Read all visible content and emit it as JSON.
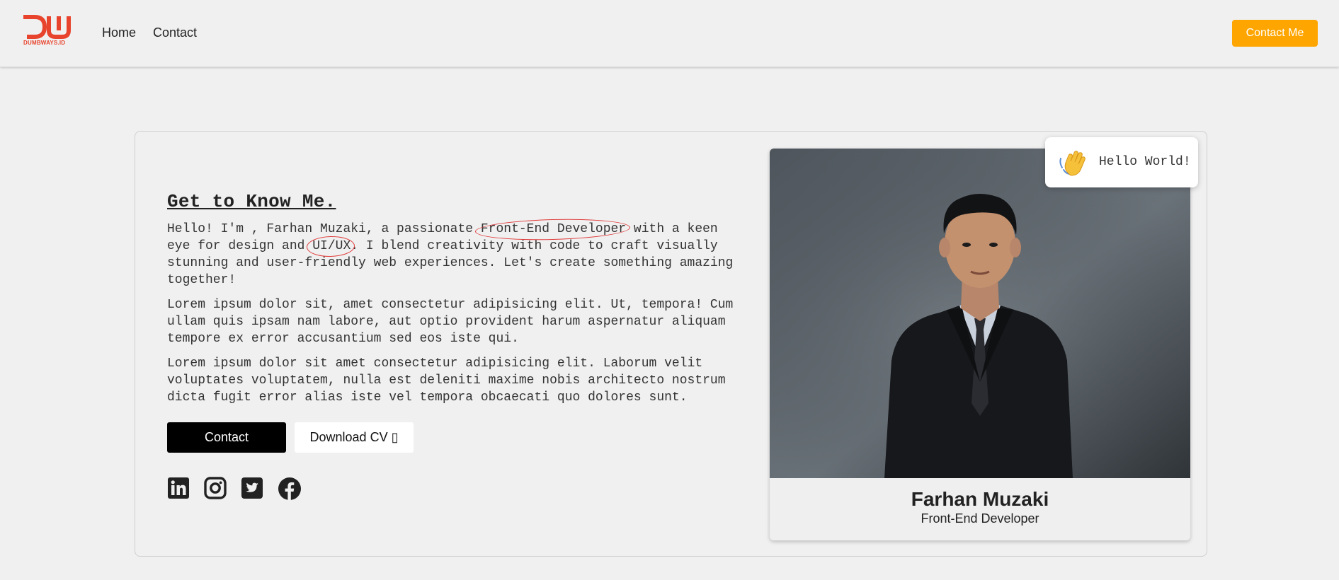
{
  "navbar": {
    "logo_text": "DUMBWAYS.ID",
    "links": [
      "Home",
      "Contact"
    ],
    "cta_label": "Contact Me"
  },
  "about": {
    "heading": "Get to Know Me.",
    "intro_before": "Hello! I'm , Farhan Muzaki, a passionate ",
    "intro_highlight_1": "Front-End Developer",
    "intro_middle": " with a keen eye for design and ",
    "intro_highlight_2": "UI/UX",
    "intro_after": ". I blend creativity with code to craft visually stunning and user-friendly web experiences. Let's create something amazing together!",
    "paragraph_2": "Lorem ipsum dolor sit, amet consectetur adipisicing elit. Ut, tempora! Cum ullam quis ipsam nam labore, aut optio provident harum aspernatur aliquam tempore ex error accusantium sed eos iste qui.",
    "paragraph_3": "Lorem ipsum dolor sit amet consectetur adipisicing elit. Laborum velit voluptates voluptatem, nulla est deleniti maxime nobis architecto nostrum dicta fugit error alias iste vel tempora obcaecati quo dolores sunt.",
    "contact_button": "Contact",
    "download_button": "Download CV ▯"
  },
  "socials": [
    {
      "icon": "linkedin-icon"
    },
    {
      "icon": "instagram-icon"
    },
    {
      "icon": "twitter-icon"
    },
    {
      "icon": "facebook-icon"
    }
  ],
  "profile": {
    "name": "Farhan Muzaki",
    "role": "Front-End Developer",
    "greeting": "Hello World!",
    "greeting_icon": "waving-hand-icon"
  },
  "colors": {
    "brand": "#e8432d",
    "accent": "#ffa500",
    "highlight_circle": "#e03a3a"
  }
}
